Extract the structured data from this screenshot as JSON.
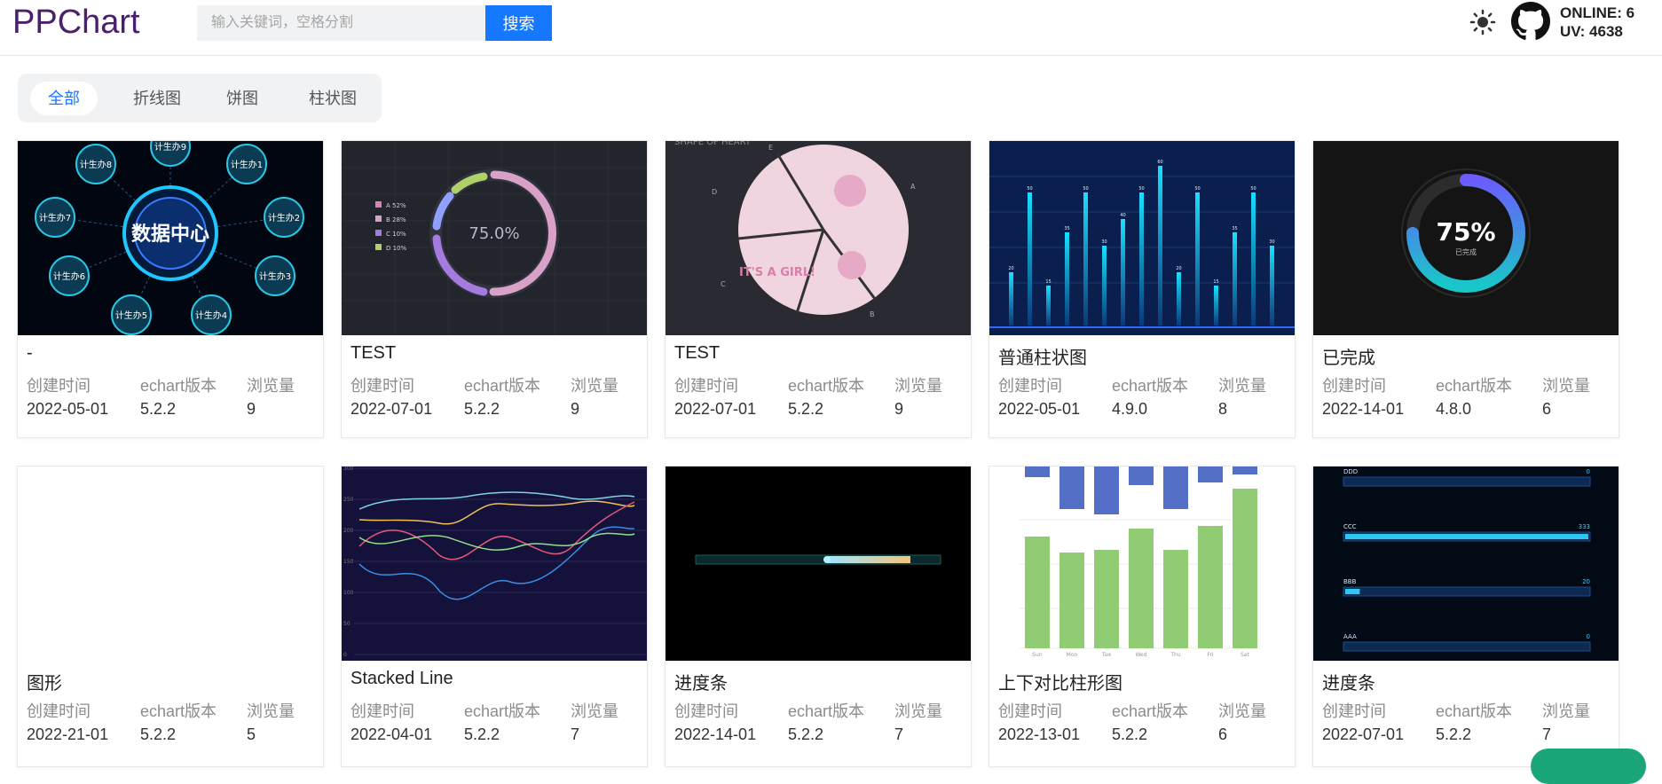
{
  "header": {
    "logo": "PPChart",
    "search_placeholder": "输入关键词，空格分割",
    "search_button": "搜索",
    "online": "ONLINE: 6",
    "uv": "UV: 4638"
  },
  "tabs": [
    "全部",
    "折线图",
    "饼图",
    "柱状图"
  ],
  "columns": {
    "created": "创建时间",
    "version": "echart版本",
    "views": "浏览量"
  },
  "cards": [
    {
      "title": "-",
      "created": "2022-05-01",
      "version": "5.2.2",
      "views": "9",
      "thumb": {
        "center": "数据中心",
        "nodes": [
          "计生办9",
          "计生办1",
          "计生办2",
          "计生办3",
          "计生办4",
          "计生办5",
          "计生办6",
          "计生办7",
          "计生办8"
        ]
      }
    },
    {
      "title": "TEST",
      "created": "2022-07-01",
      "version": "5.2.2",
      "views": "9",
      "thumb": {
        "value": "75.0%",
        "legend": [
          "A 52%",
          "B 28%",
          "C 10%",
          "D 10%"
        ]
      }
    },
    {
      "title": "TEST",
      "created": "2022-07-01",
      "version": "5.2.2",
      "views": "9",
      "thumb": {
        "heading": "SHAPE OF HEART",
        "text": "IT'S A GIRL!",
        "labels": [
          "A",
          "B",
          "C",
          "D",
          "E"
        ]
      }
    },
    {
      "title": "普通柱状图",
      "created": "2022-05-01",
      "version": "4.9.0",
      "views": "8",
      "thumb": {
        "values": [
          20,
          50,
          15,
          35,
          50,
          30,
          40,
          50,
          60,
          20,
          50,
          15,
          35,
          50,
          30
        ]
      }
    },
    {
      "title": "已完成",
      "created": "2022-14-01",
      "version": "4.8.0",
      "views": "6",
      "thumb": {
        "value": "75%",
        "label": "已完成",
        "progress": 0.75
      }
    },
    {
      "title": "图形",
      "created": "2022-21-01",
      "version": "5.2.2",
      "views": "5",
      "thumb": {}
    },
    {
      "title": "Stacked Line",
      "created": "2022-04-01",
      "version": "5.2.2",
      "views": "7",
      "thumb": {
        "yticks": [
          "300",
          "250",
          "200",
          "150",
          "100",
          "50",
          "0"
        ]
      }
    },
    {
      "title": "进度条",
      "created": "2022-14-01",
      "version": "5.2.2",
      "views": "7",
      "thumb": {
        "progress": 0.5
      }
    },
    {
      "title": "上下对比柱形图",
      "created": "2022-13-01",
      "version": "5.2.2",
      "views": "6",
      "thumb": {
        "days": [
          "Sun",
          "Mon",
          "Tue",
          "Wed",
          "Thu",
          "Fri",
          "Sat"
        ],
        "top": [
          20,
          80,
          90,
          35,
          80,
          30,
          15
        ],
        "bottom": [
          210,
          180,
          185,
          225,
          185,
          230,
          300
        ]
      }
    },
    {
      "title": "进度条",
      "created": "2022-07-01",
      "version": "5.2.2",
      "views": "7",
      "thumb": {
        "rows": [
          {
            "name": "DDD",
            "value": "0"
          },
          {
            "name": "CCC",
            "value": "333"
          },
          {
            "name": "BBB",
            "value": "20"
          },
          {
            "name": "AAA",
            "value": "0"
          }
        ]
      }
    }
  ]
}
